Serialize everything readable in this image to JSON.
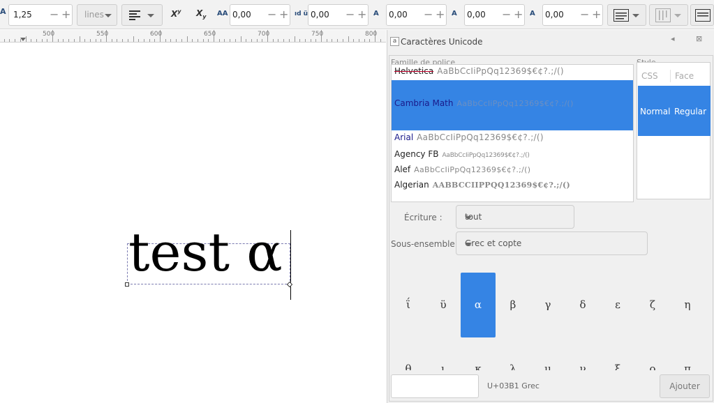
{
  "toolbar": {
    "line_height_value": "1,25",
    "unit_label": "lines",
    "letter_spacing_value": "0,00",
    "word_spacing_value": "0,00",
    "hkern_value": "0,00",
    "vkern_value": "0,00",
    "rotation_value": "0,00",
    "superscript_icon": "superscript-icon",
    "subscript_icon": "subscript-icon",
    "align_icon": "align-left-icon"
  },
  "ruler": {
    "labels": [
      "500",
      "550",
      "600",
      "650",
      "700",
      "750",
      "800"
    ]
  },
  "canvas": {
    "text": "test α"
  },
  "panel": {
    "title": "Caractères Unicode",
    "family_label": "Famille de police",
    "style_label": "Style",
    "fonts": [
      {
        "name": "Helvetica",
        "sample": "AaBbCcIiPpQq12369$€¢?.;/()"
      },
      {
        "name": "Cambria Math",
        "sample": "AaBbCcIiPpQq12369$€¢?.;/()"
      },
      {
        "name": "Arial",
        "sample": "AaBbCcIiPpQq12369$€¢?.;/()"
      },
      {
        "name": "Agency FB",
        "sample": "AaBbCcIiPpQq12369$€¢?.;/()"
      },
      {
        "name": "Alef",
        "sample": "AaBbCcIiPpQq12369$€¢?.;/()"
      },
      {
        "name": "Algerian",
        "sample": "AABBCCIIPPQQ12369$€¢?.;/()"
      }
    ],
    "style_headers": {
      "css": "CSS",
      "face": "Face"
    },
    "style_selected": {
      "css": "Normal",
      "face": "Regular"
    },
    "script_label": "Écriture :",
    "script_value": "tout",
    "subset_label": "Sous-ensemble :",
    "subset_value": "Grec et copte",
    "glyphs_row1": [
      "ΐ",
      "ϋ",
      "α",
      "β",
      "γ",
      "δ",
      "ε",
      "ζ",
      "η"
    ],
    "glyphs_row2": [
      "θ",
      "ι",
      "κ",
      "λ",
      "μ",
      "ν",
      "ξ",
      "ο",
      "π"
    ],
    "code_info": "U+03B1 Grec",
    "add_button": "Ajouter"
  },
  "colors": {
    "selection": "#3584e4",
    "toolbar_bg": "#f2f2f2"
  }
}
